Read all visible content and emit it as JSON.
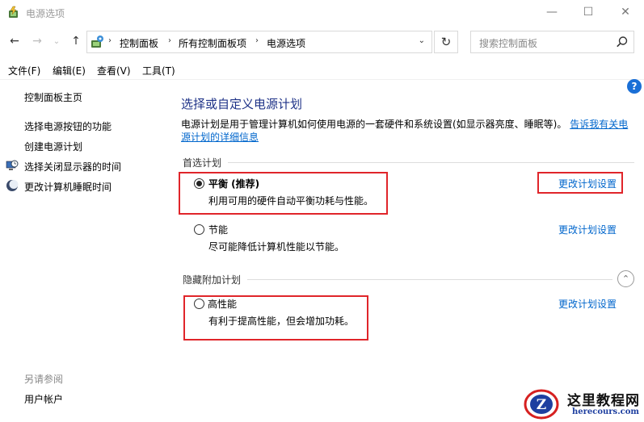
{
  "window": {
    "title": "电源选项",
    "minimize": "—",
    "maximize": "☐",
    "close": "✕"
  },
  "nav": {
    "back": "←",
    "forward": "→",
    "recent": "⌄",
    "up": "↑",
    "breadcrumbs": [
      "控制面板",
      "所有控制面板项",
      "电源选项"
    ],
    "breadcrumb_sep": "›",
    "dropdown": "⌄",
    "refresh": "↻"
  },
  "search": {
    "placeholder": "搜索控制面板"
  },
  "menu": [
    "文件(F)",
    "编辑(E)",
    "查看(V)",
    "工具(T)"
  ],
  "sidebar": {
    "home": "控制面板主页",
    "links": [
      "选择电源按钮的功能",
      "创建电源计划",
      "选择关闭显示器的时间",
      "更改计算机睡眠时间"
    ],
    "see_also_label": "另请参阅",
    "see_also": [
      "用户帐户"
    ]
  },
  "main": {
    "title": "选择或自定义电源计划",
    "description": "电源计划是用于管理计算机如何使用电源的一套硬件和系统设置(如显示器亮度、睡眠等)。",
    "description_link": "告诉我有关电源计划的详细信息",
    "preferred_label": "首选计划",
    "hidden_label": "隐藏附加计划",
    "collapse": "⌃",
    "help": "?",
    "plans": [
      {
        "name": "平衡 (推荐)",
        "desc": "利用可用的硬件自动平衡功耗与性能。",
        "link": "更改计划设置",
        "selected": true
      },
      {
        "name": "节能",
        "desc": "尽可能降低计算机性能以节能。",
        "link": "更改计划设置",
        "selected": false
      },
      {
        "name": "高性能",
        "desc": "有利于提高性能，但会增加功耗。",
        "link": "更改计划设置",
        "selected": false
      }
    ]
  },
  "watermark": {
    "title": "这里教程网",
    "url": "herecours.com",
    "logo_letter": "Z"
  },
  "colors": {
    "accent_title": "#1e3287",
    "link": "#0066cc",
    "highlight": "#e0252a"
  }
}
